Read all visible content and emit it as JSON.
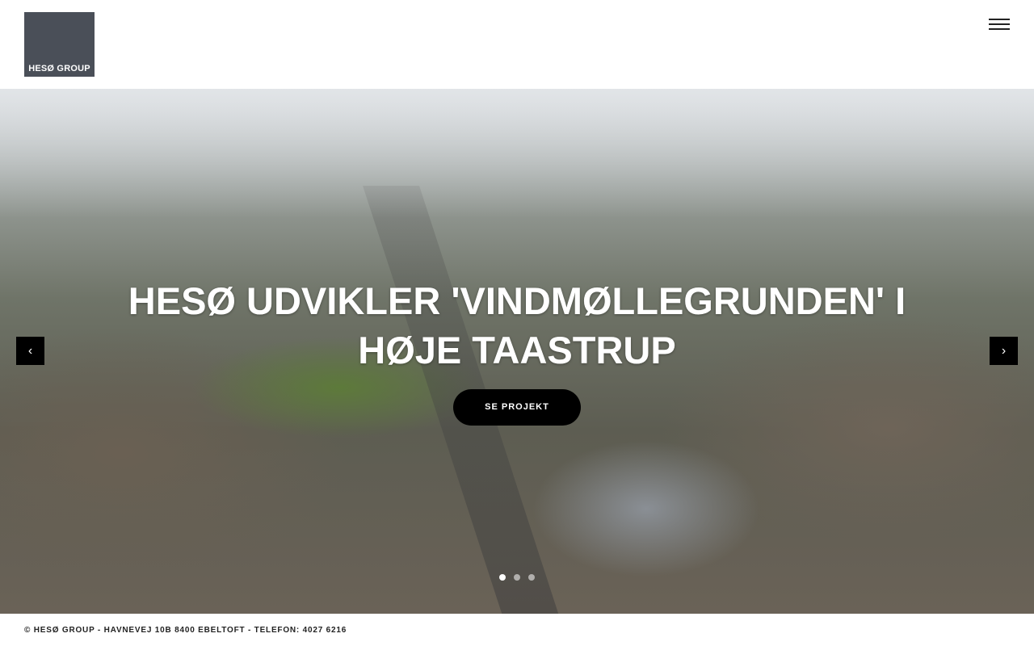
{
  "header": {
    "logo_text": "HESØ GROUP"
  },
  "hero": {
    "title": "HESØ UDVIKLER 'VINDMØLLEGRUNDEN' I HØJE TAASTRUP",
    "cta_label": "SE PROJEKT",
    "prev_icon": "‹",
    "next_icon": "›",
    "slide_count": 3,
    "active_slide": 1
  },
  "footer": {
    "text": "© HESØ GROUP - HAVNEVEJ 10B 8400 EBELTOFT - TELEFON: 4027 6216"
  }
}
